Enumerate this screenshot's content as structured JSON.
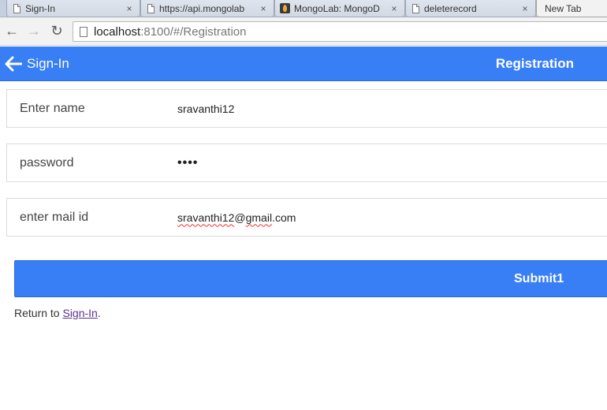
{
  "browser": {
    "tabs": [
      {
        "title": "Sign-In",
        "close": "×",
        "icon": "page-icon",
        "active": false
      },
      {
        "title": "https://api.mongolab",
        "close": "×",
        "icon": "page-icon",
        "active": false
      },
      {
        "title": "MongoLab: MongoD",
        "close": "×",
        "icon": "mongolab-icon",
        "active": false
      },
      {
        "title": "deleterecord",
        "close": "×",
        "icon": "page-icon",
        "active": false
      },
      {
        "title": "New Tab",
        "close": "",
        "icon": "none",
        "active": true
      }
    ],
    "url_host": "localhost",
    "url_path": ":8100/#/Registration"
  },
  "header": {
    "back_label": "Sign-In",
    "title": "Registration",
    "color": "#387ef5"
  },
  "form": {
    "name": {
      "label": "Enter name",
      "value": "sravanthi12"
    },
    "password": {
      "label": "password",
      "value": "••••"
    },
    "email": {
      "label": "enter mail id",
      "value_user": "sravanthi12",
      "value_at": "@",
      "value_domain": "gmail",
      "value_tld": ".com"
    },
    "submit_label": "Submit1"
  },
  "footer": {
    "prefix": "Return to ",
    "link": "Sign-In",
    "suffix": "."
  }
}
